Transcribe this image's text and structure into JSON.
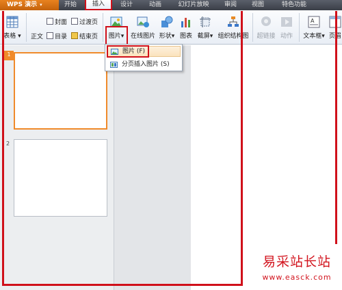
{
  "app": {
    "name": "WPS 演示"
  },
  "tabs": [
    "开始",
    "插入",
    "设计",
    "动画",
    "幻灯片放映",
    "审阅",
    "视图",
    "特色功能"
  ],
  "active_tab": "插入",
  "ribbon": {
    "table_label": "表格",
    "body_label": "正文",
    "cover_label": "封面",
    "transition_label": "过渡页",
    "toc_label": "目录",
    "end_label": "结束页",
    "picture_label": "图片",
    "online_picture_label": "在线图片",
    "shapes_label": "形状",
    "chart_label": "图表",
    "screenshot_label": "截屏",
    "org_chart_label": "组织结构图",
    "hyperlink_label": "超链接",
    "action_label": "动作",
    "textbox_label": "文本框",
    "header_label": "页眉"
  },
  "dropdown": {
    "items": [
      {
        "label": "图片 (F)",
        "hotkey": "F"
      },
      {
        "label": "分页插入图片 (S)",
        "hotkey": "S"
      }
    ]
  },
  "slides": [
    {
      "number": "1",
      "selected": true
    },
    {
      "number": "2",
      "selected": false
    }
  ],
  "watermark": {
    "site": "易采站长站",
    "url": "www.easck.com"
  },
  "colors": {
    "accent": "#f08a2a",
    "highlight": "#d0101a",
    "titlebar": "#3a3e47"
  }
}
